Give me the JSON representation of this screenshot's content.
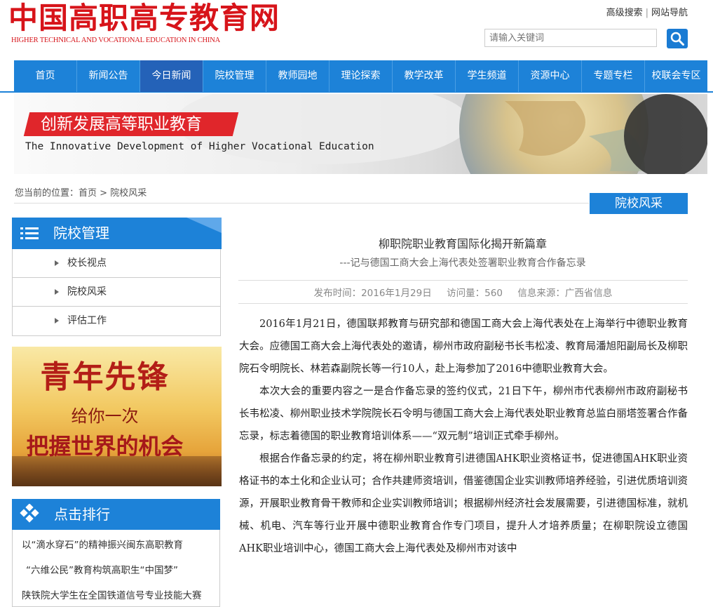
{
  "header": {
    "logo_cn": "中国高职高专教育网",
    "logo_en": "HIGHER TECHNICAL AND VOCATIONAL EDUCATION IN CHINA",
    "links": [
      "高级搜索",
      "网站导航"
    ],
    "search_placeholder": "请输入关键词"
  },
  "nav": {
    "items": [
      "首页",
      "新闻公告",
      "今日新闻",
      "院校管理",
      "教师园地",
      "理论探索",
      "教学改革",
      "学生频道",
      "资源中心",
      "专题专栏",
      "校联会专区"
    ],
    "active_index": 2
  },
  "banner": {
    "title_cn": "创新发展高等职业教育",
    "title_en": "The Innovative Development of Higher Vocational Education"
  },
  "breadcrumb": {
    "prefix": "您当前的位置：",
    "items": [
      "首页",
      "院校风采"
    ],
    "separator": ">"
  },
  "section_tag": "院校风采",
  "sidebar": {
    "title": "院校管理",
    "items": [
      "校长视点",
      "院校风采",
      "评估工作"
    ]
  },
  "ad": {
    "line1": "青年先锋",
    "line2": "给你一次",
    "line3": "把握世界的机会"
  },
  "ranking": {
    "title": "点击排行",
    "items": [
      "以“滴水穿石”的精神振兴闽东高职教育",
      "“六维公民”教育构筑高职生“中国梦”",
      "陕铁院大学生在全国铁道信号专业技能大赛"
    ]
  },
  "article": {
    "title": "柳职院职业教育国际化揭开新篇章",
    "subtitle": "---记与德国工商大会上海代表处签署职业教育合作备忘录",
    "publish_label": "发布时间：",
    "publish_date": "2016年1月29日",
    "visits_label": "访问量：",
    "visits": "560",
    "source_label": "信息来源：",
    "source": "广西省信息",
    "paragraphs": [
      "2016年1月21日，德国联邦教育与研究部和德国工商大会上海代表处在上海举行中德职业教育大会。应德国工商大会上海代表处的邀请，柳州市政府副秘书长韦松凌、教育局潘旭阳副局长及柳职院石令明院长、林若森副院长等一行10人，赴上海参加了2016中德职业教育大会。",
      "本次大会的重要内容之一是合作备忘录的签约仪式，21日下午，柳州市代表柳州市政府副秘书长韦松凌、柳州职业技术学院院长石令明与德国工商大会上海代表处职业教育总监白丽塔签署合作备忘录，标志着德国的职业教育培训体系——“双元制”培训正式牵手柳州。",
      "根据合作备忘录的约定，将在柳州职业教育引进德国AHK职业资格证书，促进德国AHK职业资格证书的本土化和企业认可；合作共建师资培训，借鉴德国企业实训教师培养经验，引进优质培训资源，开展职业教育骨干教师和企业实训教师培训；根据柳州经济社会发展需要，引进德国标准，就机械、机电、汽车等行业开展中德职业教育合作专门项目，提升人才培养质量；在柳职院设立德国AHK职业培训中心，德国工商大会上海代表处及柳州市对该中"
    ]
  }
}
